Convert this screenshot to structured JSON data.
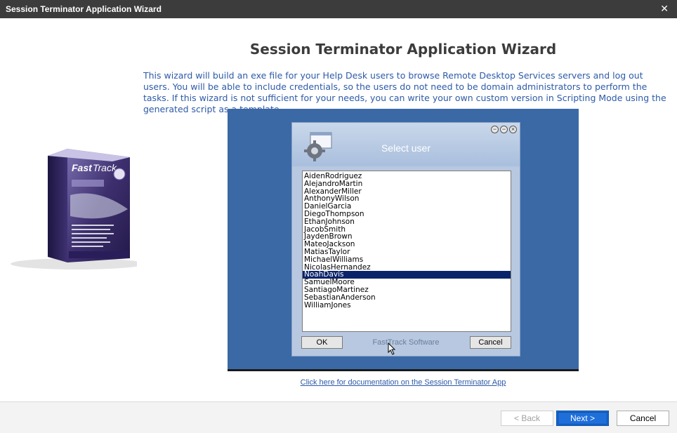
{
  "window": {
    "title": "Session Terminator Application Wizard",
    "close_glyph": "✕"
  },
  "heading": "Session Terminator Application Wizard",
  "description": "This wizard will build an exe file for your Help Desk users to browse Remote Desktop Services servers and log out users. You will be able to include credentials, so the users do not need to be domain administrators to perform the tasks. If this wizard is not sufficient for your needs, you can write your own custom version in Scripting Mode using the generated script as a template.",
  "preview": {
    "dialog_title": "Select user",
    "users": [
      "AidenRodriguez",
      "AlejandroMartin",
      "AlexanderMiller",
      "AnthonyWilson",
      "DanielGarcia",
      "DiegoThompson",
      "EthanJohnson",
      "JacobSmith",
      "JaydenBrown",
      "MateoJackson",
      "MatiasTaylor",
      "MichaelWilliams",
      "NicolasHernandez",
      "NoahDavis",
      "SamuelMoore",
      "SantiagoMartinez",
      "SebastianAnderson",
      "WilliamJones"
    ],
    "selected_user": "NoahDavis",
    "ok_label": "OK",
    "cancel_label": "Cancel",
    "brand": "FastTrack Software"
  },
  "doc_link": "Click here for documentation on the Session Terminator App",
  "footer": {
    "back_label": "< Back",
    "next_label": "Next >",
    "cancel_label": "Cancel"
  },
  "colors": {
    "accent": "#1e6fd9",
    "title_bar": "#3c3c3c",
    "preview_bg": "#3a69a6",
    "text_blue": "#2d5aa8"
  }
}
